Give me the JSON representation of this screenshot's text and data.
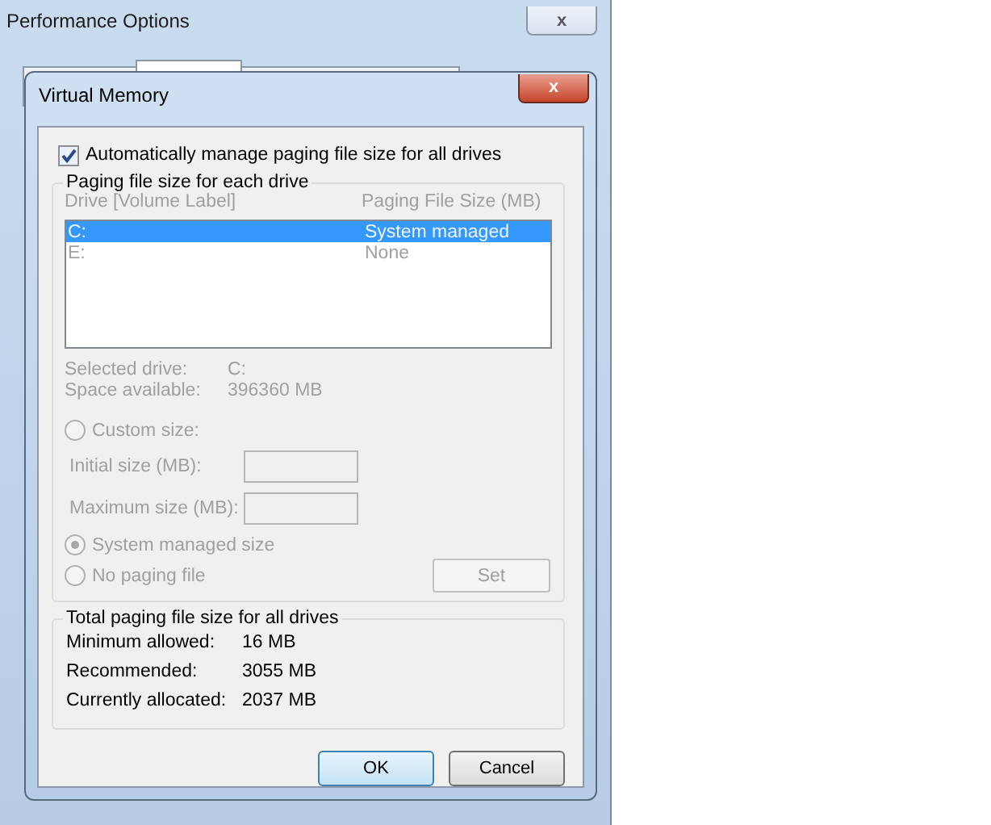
{
  "back_window": {
    "title": "Performance Options",
    "close": "x"
  },
  "dialog": {
    "title": "Virtual Memory",
    "close": "x"
  },
  "auto_manage": {
    "label": "Automatically manage paging file size for all drives",
    "checked": true
  },
  "per_drive": {
    "title": "Paging file size for each drive",
    "disabled": true,
    "columns": [
      "Drive  [Volume Label]",
      "Paging File Size (MB)"
    ],
    "rows": [
      {
        "drive": "C:",
        "size": "System managed",
        "selected": true
      },
      {
        "drive": "E:",
        "size": "None",
        "selected": false
      }
    ],
    "info": [
      {
        "label": "Selected drive:",
        "value": "C:"
      },
      {
        "label": "Space available:",
        "value": "396360 MB"
      }
    ],
    "options": [
      {
        "kind": "radio",
        "label": "Custom size:",
        "selected": false
      },
      {
        "kind": "field",
        "label": "Initial size (MB):"
      },
      {
        "kind": "field",
        "label": "Maximum size (MB):"
      },
      {
        "kind": "radio",
        "label": "System managed size",
        "selected": true
      },
      {
        "kind": "radio",
        "label": "No paging file",
        "selected": false
      }
    ],
    "set_button": "Set"
  },
  "totals": {
    "title": "Total paging file size for all drives",
    "rows": [
      {
        "label": "Minimum allowed:",
        "value": "16 MB"
      },
      {
        "label": "Recommended:",
        "value": "3055 MB"
      },
      {
        "label": "Currently allocated:",
        "value": "2037 MB"
      }
    ]
  },
  "buttons": [
    {
      "label": "OK",
      "default": true
    },
    {
      "label": "Cancel",
      "default": false
    }
  ]
}
